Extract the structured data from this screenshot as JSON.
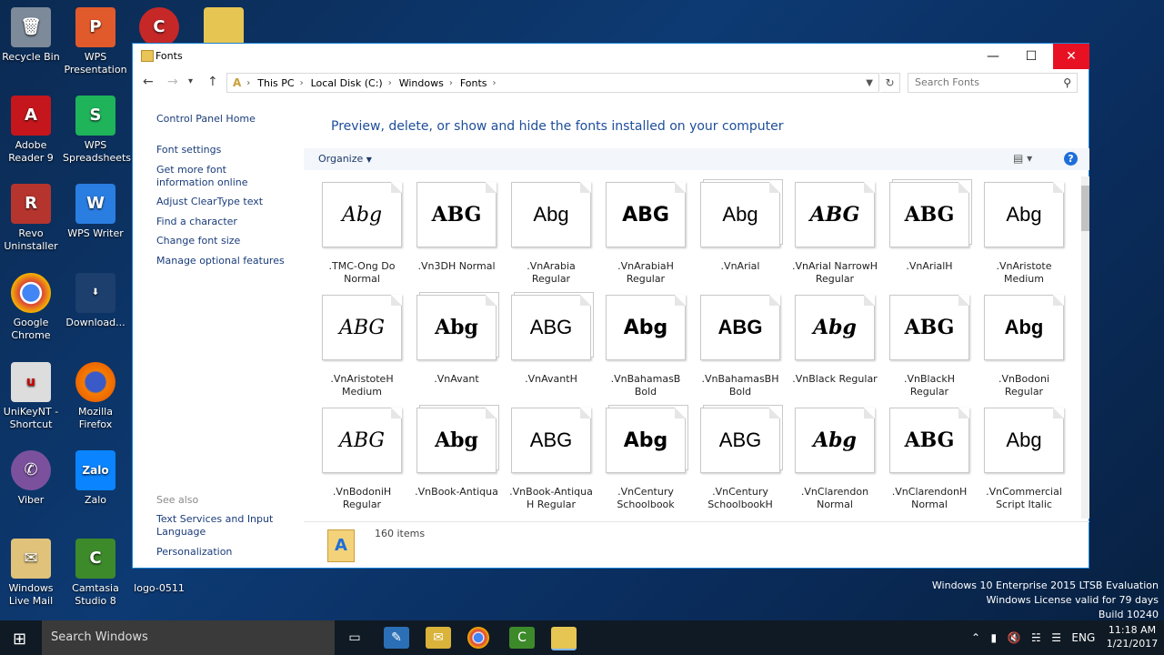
{
  "desktop": {
    "icons": [
      {
        "label": "Recycle Bin"
      },
      {
        "label": "WPS Presentation"
      },
      {
        "label": "Adobe Reader 9"
      },
      {
        "label": "WPS Spreadsheets"
      },
      {
        "label": "Revo Uninstaller"
      },
      {
        "label": "WPS Writer"
      },
      {
        "label": "Google Chrome"
      },
      {
        "label": "Download..."
      },
      {
        "label": "UniKeyNT - Shortcut"
      },
      {
        "label": "Mozilla Firefox"
      },
      {
        "label": "Viber"
      },
      {
        "label": "Zalo"
      },
      {
        "label": "Windows Live Mail"
      },
      {
        "label": "Camtasia Studio 8"
      },
      {
        "label": "logo-0511"
      }
    ]
  },
  "window": {
    "title": "Fonts",
    "address": [
      "This PC",
      "Local Disk (C:)",
      "Windows",
      "Fonts"
    ],
    "search_placeholder": "Search Fonts",
    "left_links": [
      "Control Panel Home",
      "Font settings",
      "Get more font information online",
      "Adjust ClearType text",
      "Find a character",
      "Change font size",
      "Manage optional features"
    ],
    "see_also_label": "See also",
    "see_also_links": [
      "Text Services and Input Language",
      "Personalization"
    ],
    "heading": "Preview, delete, or show and hide the fonts installed on your computer",
    "organize_label": "Organize",
    "help_label": "?",
    "fonts": [
      {
        "preview": "Abg",
        "name": ".TMC-Ong Do Normal"
      },
      {
        "preview": "ABG",
        "name": ".Vn3DH Normal"
      },
      {
        "preview": "Abg",
        "name": ".VnArabia Regular"
      },
      {
        "preview": "ABG",
        "name": ".VnArabiaH Regular"
      },
      {
        "preview": "Abg",
        "name": ".VnArial"
      },
      {
        "preview": "ABG",
        "name": ".VnArial NarrowH Regular"
      },
      {
        "preview": "ABG",
        "name": ".VnArialH"
      },
      {
        "preview": "Abg",
        "name": ".VnAristote Medium"
      },
      {
        "preview": "ABG",
        "name": ".VnAristoteH Medium"
      },
      {
        "preview": "Abg",
        "name": ".VnAvant"
      },
      {
        "preview": "ABG",
        "name": ".VnAvantH"
      },
      {
        "preview": "Abg",
        "name": ".VnBahamasB Bold"
      },
      {
        "preview": "ABG",
        "name": ".VnBahamasBH Bold"
      },
      {
        "preview": "Abg",
        "name": ".VnBlack Regular"
      },
      {
        "preview": "ABG",
        "name": ".VnBlackH Regular"
      },
      {
        "preview": "Abg",
        "name": ".VnBodoni Regular"
      },
      {
        "preview": "ABG",
        "name": ".VnBodoniH Regular"
      },
      {
        "preview": "Abg",
        "name": ".VnBook-Antiqua"
      },
      {
        "preview": "ABG",
        "name": ".VnBook-Antiqua H Regular"
      },
      {
        "preview": "Abg",
        "name": ".VnCentury Schoolbook"
      },
      {
        "preview": "ABG",
        "name": ".VnCentury SchoolbookH"
      },
      {
        "preview": "Abg",
        "name": ".VnClarendon Normal"
      },
      {
        "preview": "ABG",
        "name": ".VnClarendonH Normal"
      },
      {
        "preview": "Abg",
        "name": ".VnCommercial Script Italic"
      }
    ],
    "item_count": "160 items"
  },
  "watermark": [
    "Windows 10 Enterprise 2015 LTSB Evaluation",
    "Windows License valid for 79 days",
    "Build 10240"
  ],
  "taskbar": {
    "search_placeholder": "Search Windows",
    "language": "ENG",
    "time": "11:18 AM",
    "date": "1/21/2017"
  }
}
